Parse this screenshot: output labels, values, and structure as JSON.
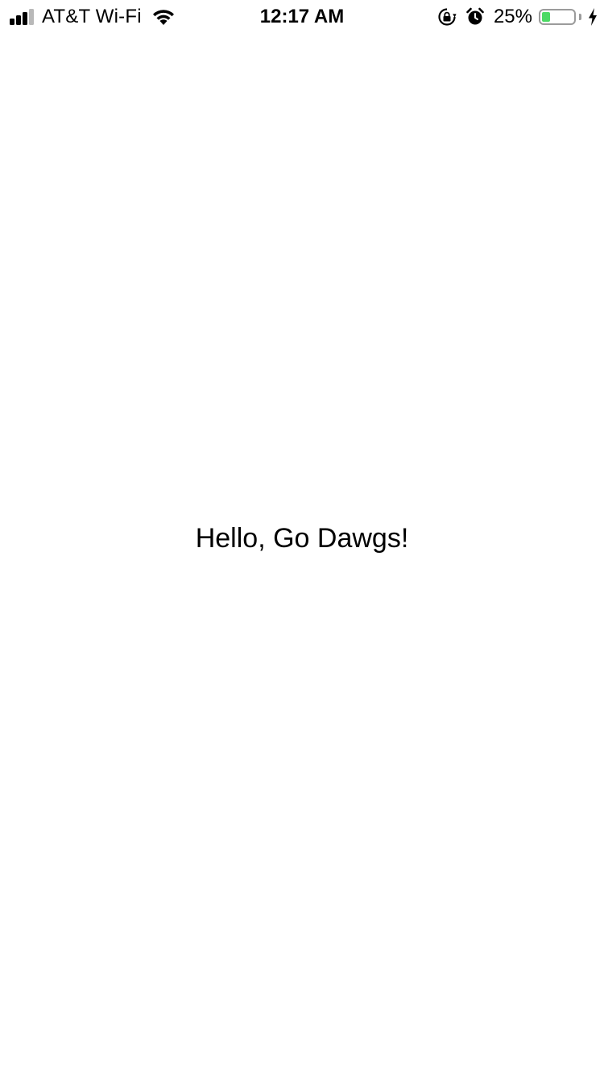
{
  "status_bar": {
    "signal_bars_filled": 3,
    "signal_bars_total": 4,
    "carrier": "AT&T Wi-Fi",
    "wifi_icon": "wifi-icon",
    "time": "12:17 AM",
    "orientation_lock_icon": "orientation-lock-icon",
    "alarm_icon": "alarm-clock-icon",
    "battery_percent": "25%",
    "battery_level": 0.25,
    "battery_color": "#4cd964",
    "charging_icon": "charging-bolt-icon"
  },
  "main": {
    "greeting": "Hello, Go Dawgs!"
  }
}
